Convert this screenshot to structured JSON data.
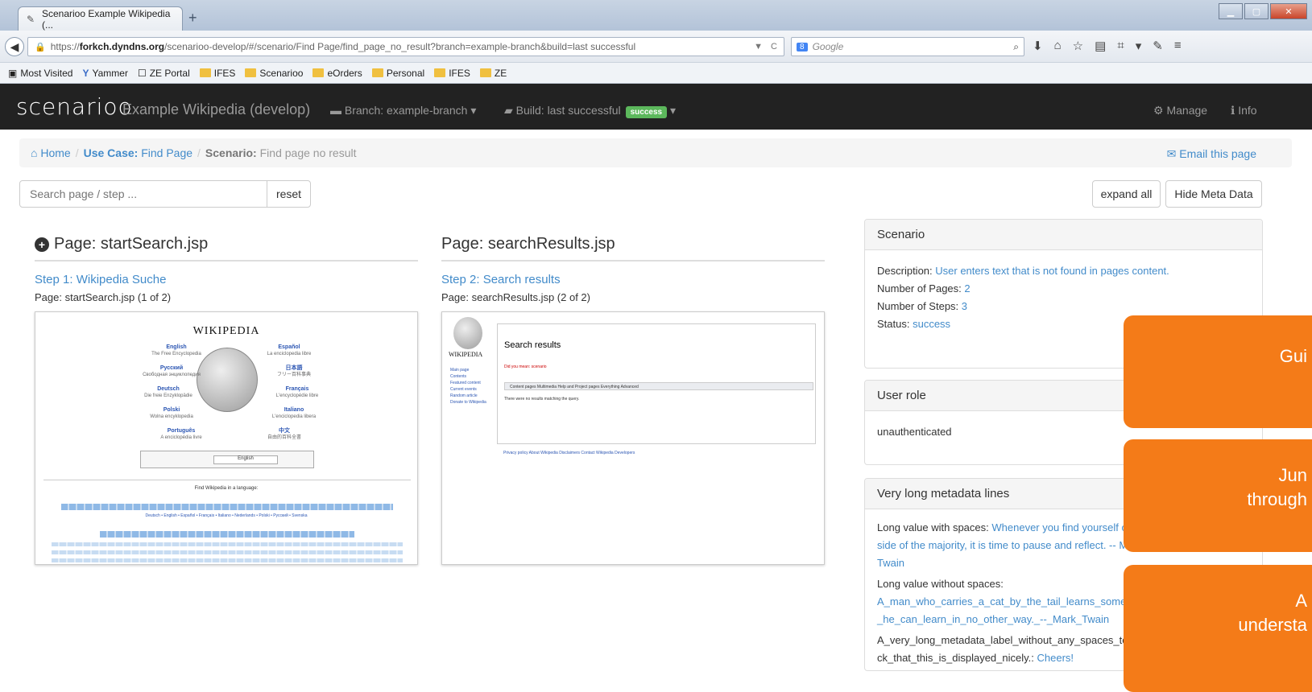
{
  "browser": {
    "tab_title": "Scenarioo Example Wikipedia (...",
    "url_prefix": "https://",
    "url_host": "forkch.dyndns.org",
    "url_path": "/scenarioo-develop/#/scenario/Find Page/find_page_no_result?branch=example-branch&build=last successful",
    "search_engine": "Google"
  },
  "bookmarks": [
    "Most Visited",
    "Yammer",
    "ZE Portal",
    "IFES",
    "Scenarioo",
    "eOrders",
    "Personal",
    "IFES",
    "ZE"
  ],
  "app": {
    "logo": "scenarioo",
    "name": "Example Wikipedia (develop)",
    "branch": "Branch: example-branch",
    "build": "Build: last successful",
    "build_status": "success",
    "manage": "Manage",
    "info": "Info"
  },
  "breadcrumb": {
    "home": "Home",
    "usecase_label": "Use Case:",
    "usecase": "Find Page",
    "scenario_label": "Scenario:",
    "scenario": "Find page no result",
    "email": "Email this page"
  },
  "search": {
    "placeholder": "Search page / step ...",
    "reset": "reset",
    "expand_all": "expand all",
    "hide_meta": "Hide Meta Data"
  },
  "pages": [
    {
      "title": "Page: startSearch.jsp",
      "step": "Step 1: Wikipedia Suche",
      "page_info": "Page: startSearch.jsp (1 of 2)"
    },
    {
      "title": "Page: searchResults.jsp",
      "step": "Step 2: Search results",
      "page_info": "Page: searchResults.jsp (2 of 2)"
    }
  ],
  "thumb1": {
    "title": "WIKIPEDIA",
    "langs": [
      {
        "name": "English",
        "sub": "The Free Encyclopedia"
      },
      {
        "name": "Español",
        "sub": "La enciclopedia libre"
      },
      {
        "name": "Русский",
        "sub": "Свободная энциклопедия"
      },
      {
        "name": "日本語",
        "sub": "フリー百科事典"
      },
      {
        "name": "Deutsch",
        "sub": "Die freie Enzyklopädie"
      },
      {
        "name": "Français",
        "sub": "L'encyclopédie libre"
      },
      {
        "name": "Polski",
        "sub": "Wolna encyklopedia"
      },
      {
        "name": "Italiano",
        "sub": "L'enciclopedia libera"
      },
      {
        "name": "Português",
        "sub": "A enciclopédia livre"
      },
      {
        "name": "中文",
        "sub": "自由的百科全書"
      }
    ],
    "select": "English",
    "find": "Find Wikipedia in a language:",
    "line1": "Deutsch • English • Español • Français • Italiano • Nederlands • Polski • Русский • Svenska"
  },
  "thumb2": {
    "heading": "Search results",
    "did_you_mean": "Did you mean: scenario",
    "no_results": "There were no results matching the query.",
    "side": [
      "Main page",
      "Contents",
      "Featured content",
      "Current events",
      "Random article",
      "Donate to Wikipedia"
    ],
    "tabs": "Content pages   Multimedia   Help and Project pages   Everything   Advanced",
    "footer": "Privacy policy   About Wikipedia   Disclaimers   Contact Wikipedia   Developers"
  },
  "scenario_panel": {
    "title": "Scenario",
    "desc_label": "Description:",
    "desc": "User enters text that is not found in pages content.",
    "pages_label": "Number of Pages:",
    "pages": "2",
    "steps_label": "Number of Steps:",
    "steps": "3",
    "status_label": "Status:",
    "status": "success"
  },
  "userrole_panel": {
    "title": "User role",
    "value": "unauthenticated"
  },
  "longmeta_panel": {
    "title": "Very long metadata lines",
    "l1_label": "Long value with spaces:",
    "l1_value": "Whenever you find yourself on the side of the majority, it is time to pause and reflect. -- Mark Twain",
    "l2_label": "Long value without spaces:",
    "l2_value": "A_man_who_carries_a_cat_by_the_tail_learns_something_he_can_learn_in_no_other_way._--_Mark_Twain",
    "l3_label": "A_very_long_metadata_label_without_any_spaces_to_check_that_this_is_displayed_nicely.:",
    "l3_value": "Cheers!"
  },
  "overlays": [
    "Gui",
    "Jun",
    "through",
    "A",
    "understa"
  ],
  "colors": {
    "accent": "#428bca",
    "orange": "#f47b18",
    "success": "#5cb85c",
    "appbar": "#222222"
  }
}
